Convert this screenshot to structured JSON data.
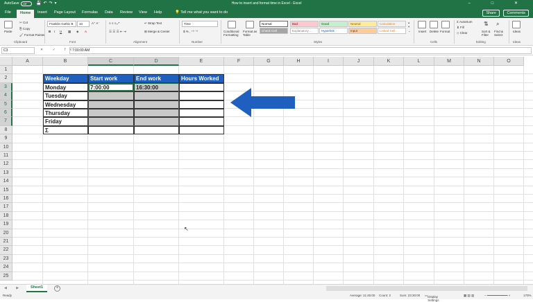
{
  "titlebar": {
    "autosave_label": "AutoSave",
    "autosave_state": "Off",
    "document_title": "How to insert and format time in Excel  -  Excel",
    "window_controls": "– □ ✕"
  },
  "tabs": [
    "File",
    "Home",
    "Insert",
    "Page Layout",
    "Formulas",
    "Data",
    "Review",
    "View",
    "Help"
  ],
  "active_tab": "Home",
  "tell_me": "Tell me what you want to do",
  "share_label": "Share",
  "comments_label": "Comments",
  "ribbon": {
    "clipboard": {
      "paste": "Paste",
      "cut": "Cut",
      "copy": "Copy",
      "format_painter": "Format Painter",
      "label": "Clipboard"
    },
    "font": {
      "name": "Franklin Gothic B",
      "size": "10",
      "label": "Font"
    },
    "alignment": {
      "wrap": "Wrap Text",
      "merge": "Merge & Center",
      "label": "Alignment"
    },
    "number": {
      "format": "Time",
      "label": "Number"
    },
    "styles": {
      "conditional": "Conditional Formatting",
      "format_as_table": "Format as Table",
      "cells": [
        {
          "text": "Normal",
          "bg": "#ffffff",
          "fg": "#000000"
        },
        {
          "text": "Bad",
          "bg": "#ffc7ce",
          "fg": "#9c0006"
        },
        {
          "text": "Good",
          "bg": "#c6efce",
          "fg": "#006100"
        },
        {
          "text": "Neutral",
          "bg": "#ffeb9c",
          "fg": "#9c5700"
        },
        {
          "text": "Calculation",
          "bg": "#f2f2f2",
          "fg": "#fa7d00"
        },
        {
          "text": "Check Cell",
          "bg": "#a5a5a5",
          "fg": "#ffffff"
        },
        {
          "text": "Explanatory ...",
          "bg": "#ffffff",
          "fg": "#7f7f7f"
        },
        {
          "text": "Hyperlink",
          "bg": "#ffffff",
          "fg": "#0563c1"
        },
        {
          "text": "Input",
          "bg": "#ffcc99",
          "fg": "#3f3f76"
        },
        {
          "text": "Linked Cell",
          "bg": "#ffffff",
          "fg": "#fa7d00"
        }
      ],
      "label": "Styles"
    },
    "cells_group": {
      "insert": "Insert",
      "delete": "Delete",
      "format": "Format",
      "label": "Cells"
    },
    "editing": {
      "autosum": "AutoSum",
      "fill": "Fill",
      "clear": "Clear",
      "sort": "Sort & Filter",
      "find": "Find & Select",
      "label": "Editing"
    },
    "ideas": {
      "ideas": "Ideas",
      "label": "Ideas"
    }
  },
  "formula_bar": {
    "name_box": "C3",
    "fx": "✕  ✓  fx",
    "formula": "7:00:00 AM"
  },
  "columns": [
    "A",
    "B",
    "C",
    "D",
    "E",
    "F",
    "G",
    "H",
    "I",
    "J",
    "K",
    "L",
    "M",
    "N",
    "O"
  ],
  "rows": [
    "1",
    "2",
    "3",
    "4",
    "5",
    "6",
    "7",
    "8",
    "9",
    "10",
    "11",
    "12",
    "13",
    "14",
    "15",
    "16",
    "17",
    "18",
    "19",
    "20",
    "21",
    "22",
    "23",
    "24",
    "25"
  ],
  "table": {
    "headers": [
      "Weekday",
      "Start work",
      "End work",
      "Hours Worked"
    ],
    "rows": [
      [
        "Monday",
        "7:00:00",
        "16:30:00",
        ""
      ],
      [
        "Tuesday",
        "",
        "",
        ""
      ],
      [
        "Wednesday",
        "",
        "",
        ""
      ],
      [
        "Thursday",
        "",
        "",
        ""
      ],
      [
        "Friday",
        "",
        "",
        ""
      ],
      [
        "Σ",
        "",
        "",
        ""
      ]
    ]
  },
  "sheet_tab": "Sheet1",
  "status": {
    "ready": "Ready",
    "average": "Average: 11:45:00",
    "count": "Count: 2",
    "sum": "Sum: 23:30:00",
    "display": "Display Settings",
    "zoom": "170%"
  },
  "colors": {
    "excel_green": "#217346",
    "header_blue": "#1f5fbf",
    "arrow_blue": "#1f5fbf",
    "selection_gray": "#c8c8c8"
  }
}
